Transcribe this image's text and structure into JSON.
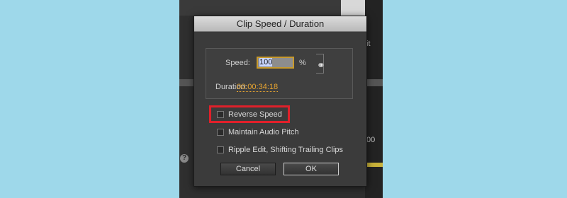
{
  "dialog": {
    "title": "Clip Speed / Duration",
    "speed_label": "Speed:",
    "speed_value": "100",
    "speed_unit": "%",
    "duration_label": "Duration:",
    "duration_value": "00:00:34:18",
    "link_icon": "chain-link-icon",
    "checkboxes": [
      {
        "label": "Reverse Speed",
        "checked": false
      },
      {
        "label": "Maintain Audio Pitch",
        "checked": false
      },
      {
        "label": "Ripple Edit, Shifting Trailing Clips",
        "checked": false
      }
    ],
    "cancel_label": "Cancel",
    "ok_label": "OK"
  },
  "background": {
    "fragment_it": "it",
    "fragment_00": "00",
    "fragment_q": "?"
  },
  "colors": {
    "page_bg": "#9ed8ea",
    "dialog_bg": "#3b3b3b",
    "duration_accent": "#e8a530",
    "highlight": "#e0202a"
  }
}
